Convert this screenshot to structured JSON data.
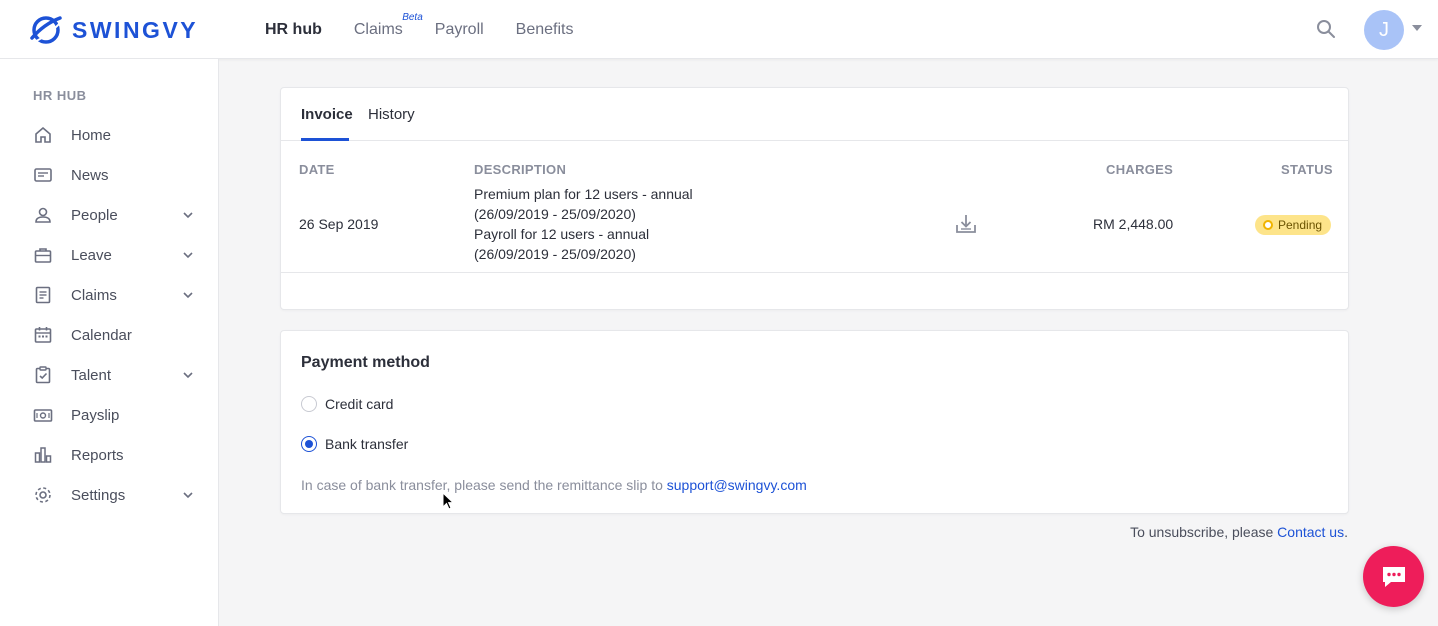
{
  "brand": {
    "name": "SWINGVY",
    "color": "#1d52d6"
  },
  "topnav": {
    "items": [
      {
        "label": "HR hub",
        "active": true
      },
      {
        "label": "Claims",
        "badge": "Beta"
      },
      {
        "label": "Payroll"
      },
      {
        "label": "Benefits"
      }
    ]
  },
  "user": {
    "initial": "J"
  },
  "sidebar": {
    "heading": "HR HUB",
    "items": [
      {
        "label": "Home",
        "icon": "home-icon"
      },
      {
        "label": "News",
        "icon": "news-icon"
      },
      {
        "label": "People",
        "icon": "person-icon",
        "expandable": true
      },
      {
        "label": "Leave",
        "icon": "briefcase-icon",
        "expandable": true
      },
      {
        "label": "Claims",
        "icon": "document-icon",
        "expandable": true
      },
      {
        "label": "Calendar",
        "icon": "calendar-icon"
      },
      {
        "label": "Talent",
        "icon": "clipboard-icon",
        "expandable": true
      },
      {
        "label": "Payslip",
        "icon": "money-icon"
      },
      {
        "label": "Reports",
        "icon": "bar-chart-icon"
      },
      {
        "label": "Settings",
        "icon": "gear-icon",
        "expandable": true
      }
    ]
  },
  "invoice": {
    "tabs": [
      {
        "label": "Invoice",
        "active": true
      },
      {
        "label": "History"
      }
    ],
    "columns": {
      "date": "DATE",
      "description": "DESCRIPTION",
      "charges": "CHARGES",
      "status": "STATUS"
    },
    "rows": [
      {
        "date": "26 Sep 2019",
        "description": [
          "Premium plan for 12 users - annual",
          "(26/09/2019 - 25/09/2020)",
          "Payroll for 12 users - annual",
          "(26/09/2019 - 25/09/2020)"
        ],
        "charges": "RM 2,448.00",
        "status": "Pending",
        "status_color": "#fde48a"
      }
    ]
  },
  "payment": {
    "title": "Payment method",
    "options": [
      {
        "label": "Credit card",
        "selected": false
      },
      {
        "label": "Bank transfer",
        "selected": true
      }
    ],
    "note_prefix": "In case of bank transfer, please send the remittance slip to ",
    "note_email": "support@swingvy.com"
  },
  "footer": {
    "prefix": "To unsubscribe, please ",
    "link": "Contact us",
    "suffix": "."
  },
  "colors": {
    "accent": "#1d52d6",
    "chat": "#ee1d5a",
    "pending": "#fde48a"
  }
}
